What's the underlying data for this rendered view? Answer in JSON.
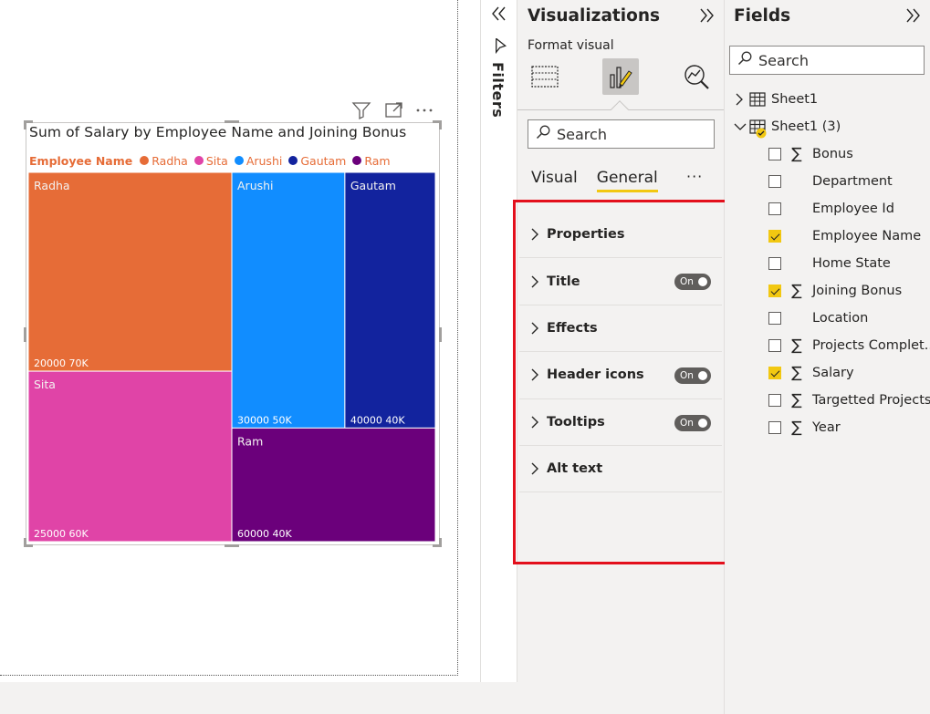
{
  "canvas": {
    "chart_title": "Sum of Salary by Employee Name and Joining Bonus",
    "legend_title": "Employee Name"
  },
  "chart_data": {
    "type": "treemap",
    "title": "Sum of Salary by Employee Name and Joining Bonus",
    "legend": {
      "title": "Employee Name",
      "position": "top-left"
    },
    "tiles": [
      {
        "name": "Radha",
        "salary": 70000,
        "joining_bonus": 20000,
        "value_label": "20000 70K",
        "color": "#e66c37"
      },
      {
        "name": "Sita",
        "salary": 60000,
        "joining_bonus": 25000,
        "value_label": "25000 60K",
        "color": "#e044a7"
      },
      {
        "name": "Arushi",
        "salary": 50000,
        "joining_bonus": 30000,
        "value_label": "30000 50K",
        "color": "#118dff"
      },
      {
        "name": "Gautam",
        "salary": 40000,
        "joining_bonus": 40000,
        "value_label": "40000 40K",
        "color": "#12239e"
      },
      {
        "name": "Ram",
        "salary": 40000,
        "joining_bonus": 60000,
        "value_label": "60000 40K",
        "color": "#6b007b"
      }
    ]
  },
  "filters": {
    "label": "Filters"
  },
  "visualizations": {
    "title": "Visualizations",
    "format_visual_label": "Format visual",
    "search_placeholder": "Search",
    "tabs": [
      {
        "label": "Visual",
        "active": false
      },
      {
        "label": "General",
        "active": true
      }
    ],
    "more": "···",
    "cards": [
      {
        "label": "Properties",
        "toggle": null
      },
      {
        "label": "Title",
        "toggle": "On"
      },
      {
        "label": "Effects",
        "toggle": null
      },
      {
        "label": "Header icons",
        "toggle": "On"
      },
      {
        "label": "Tooltips",
        "toggle": "On"
      },
      {
        "label": "Alt text",
        "toggle": null
      }
    ],
    "highlight_color": "#e3101c"
  },
  "fields": {
    "title": "Fields",
    "search_placeholder": "Search",
    "tables": [
      {
        "label": "Sheet1",
        "expanded": false
      },
      {
        "label": "Sheet1 (3)",
        "expanded": true
      }
    ],
    "items": [
      {
        "label": "Bonus",
        "checked": false,
        "sigma": true
      },
      {
        "label": "Department",
        "checked": false,
        "sigma": false
      },
      {
        "label": "Employee Id",
        "checked": false,
        "sigma": false
      },
      {
        "label": "Employee Name",
        "checked": true,
        "sigma": false
      },
      {
        "label": "Home State",
        "checked": false,
        "sigma": false
      },
      {
        "label": "Joining Bonus",
        "checked": true,
        "sigma": true
      },
      {
        "label": "Location",
        "checked": false,
        "sigma": false
      },
      {
        "label": "Projects Complet...",
        "checked": false,
        "sigma": true
      },
      {
        "label": "Salary",
        "checked": true,
        "sigma": true
      },
      {
        "label": "Targetted Projects",
        "checked": false,
        "sigma": true
      },
      {
        "label": "Year",
        "checked": false,
        "sigma": true
      }
    ],
    "accent": "#f2c811"
  }
}
